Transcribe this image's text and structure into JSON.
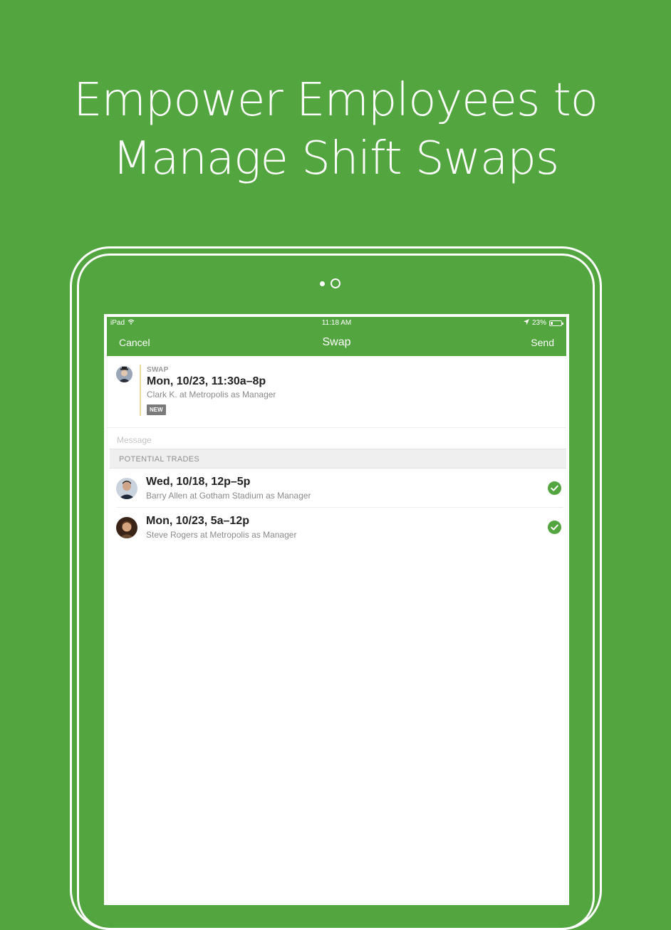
{
  "headline": {
    "line1": "Empower Employees to",
    "line2": "Manage Shift Swaps"
  },
  "statusbar": {
    "device": "iPad",
    "time": "11:18 AM",
    "battery": "23%",
    "battery_level": 0.23
  },
  "navbar": {
    "cancel": "Cancel",
    "title": "Swap",
    "send": "Send"
  },
  "swap": {
    "label": "SWAP",
    "datetime": "Mon, 10/23, 11:30a–8p",
    "detail": "Clark K. at Metropolis as Manager",
    "badge": "NEW"
  },
  "message_placeholder": "Message",
  "trades": {
    "header": "POTENTIAL TRADES",
    "items": [
      {
        "datetime": "Wed, 10/18, 12p–5p",
        "detail": "Barry Allen at Gotham Stadium as Manager",
        "selected": true
      },
      {
        "datetime": "Mon, 10/23, 5a–12p",
        "detail": "Steve Rogers at Metropolis as Manager",
        "selected": true
      }
    ]
  },
  "colors": {
    "brand": "#53a53f",
    "badge": "#7a7a7a",
    "accent_bar": "#e8d99a"
  }
}
